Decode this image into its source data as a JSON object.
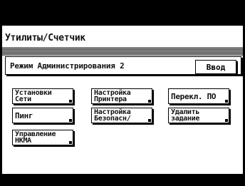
{
  "window": {
    "title": "Утилиты/Счетчик"
  },
  "mode": {
    "label": "Режим Администрирования 2",
    "enter_button": "Ввод"
  },
  "buttons": [
    {
      "line1": "Установки",
      "line2": "Сети"
    },
    {
      "line1": "Настройка",
      "line2": "Принтера"
    },
    {
      "line1": "Перекл. ПО",
      "line2": ""
    },
    {
      "line1": "Пинг",
      "line2": ""
    },
    {
      "line1": "Настройка",
      "line2": "Безопасн/"
    },
    {
      "line1": "Удалить",
      "line2": "задание"
    },
    {
      "line1": "Управление",
      "line2": "НКМА"
    }
  ]
}
